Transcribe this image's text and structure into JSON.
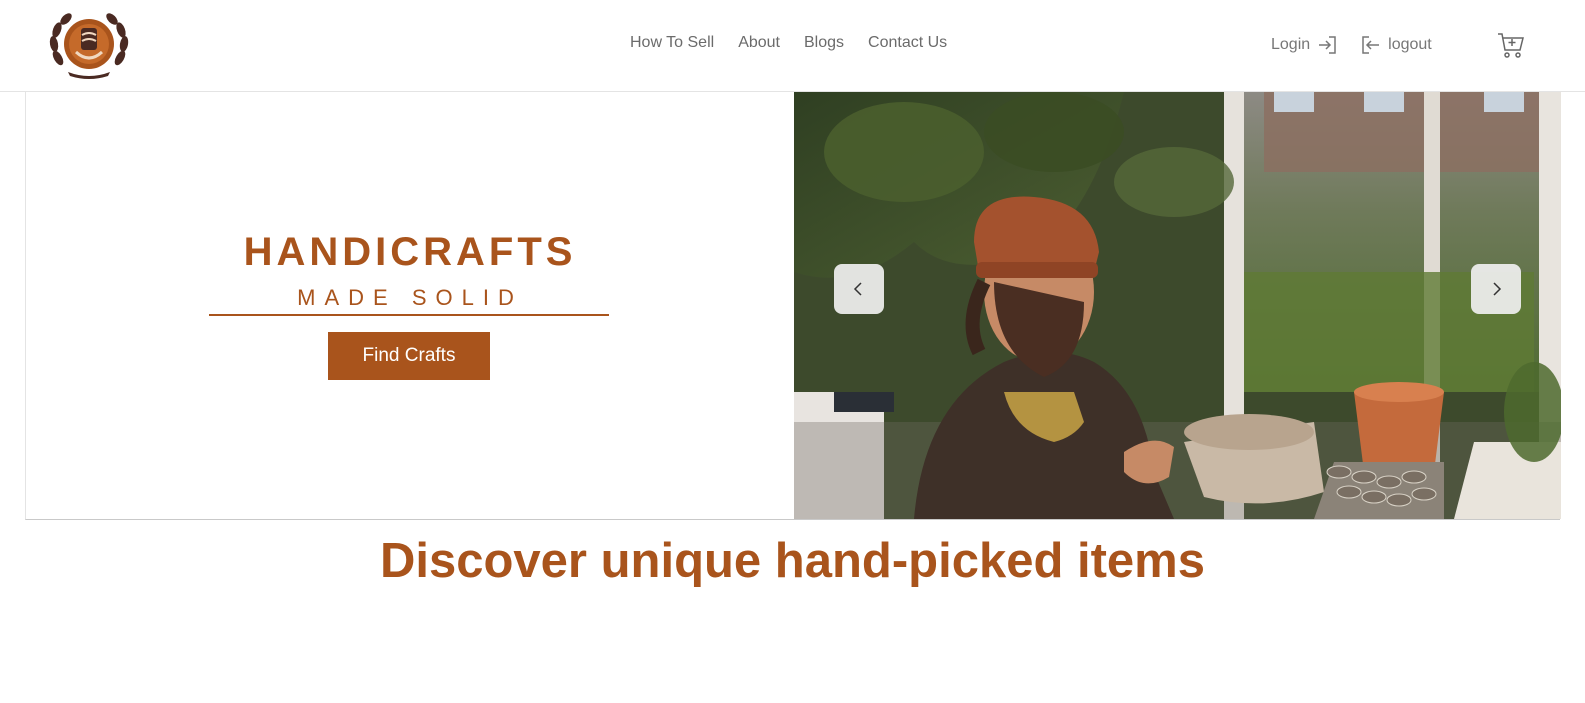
{
  "header": {
    "nav": [
      "How To Sell",
      "About",
      "Blogs",
      "Contact Us"
    ],
    "login_label": "Login",
    "logout_label": "logout",
    "icons": {
      "logo": "laurel-wreath-logo",
      "login": "login-icon",
      "logout": "logout-icon",
      "cart": "cart-plus-icon"
    }
  },
  "hero": {
    "title": "HANDICRAFTS",
    "subtitle": "MADE SOLID",
    "cta_label": "Find Crafts",
    "carousel": {
      "prev_icon": "chevron-left-icon",
      "next_icon": "chevron-right-icon",
      "image_subject": "potter-painting-vase-photo"
    }
  },
  "section": {
    "headline": "Discover unique hand-picked items"
  },
  "colors": {
    "brand": "#a9541c",
    "nav_text": "#6b6b6b",
    "arrow_bg": "#f0f0f0"
  }
}
